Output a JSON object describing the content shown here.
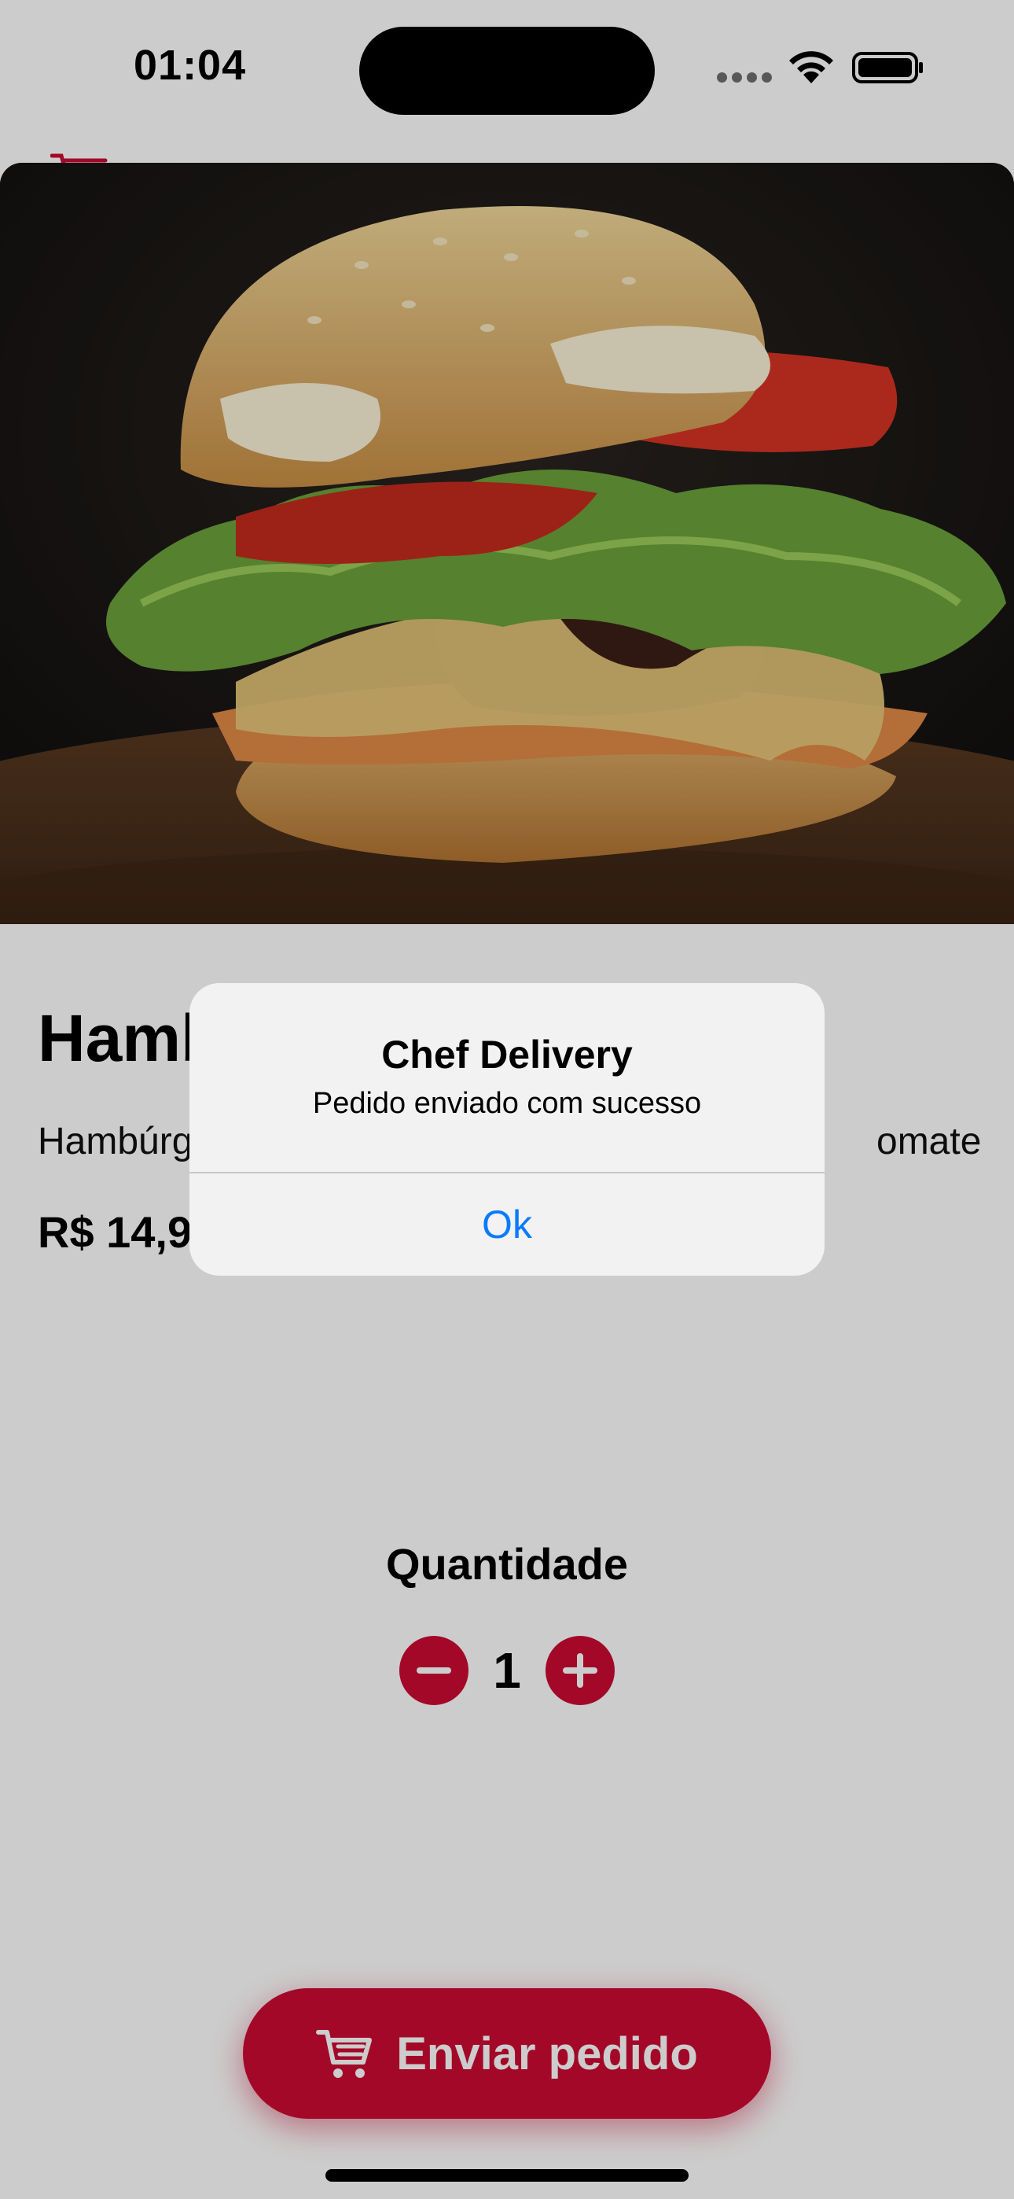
{
  "status_bar": {
    "time": "01:04",
    "icons": [
      "signal-dots-icon",
      "wifi-icon",
      "battery-icon"
    ]
  },
  "product": {
    "image": "hamburger-photo",
    "title": "Hamb",
    "description": "Hambúrg",
    "description_tail": "omate",
    "price": "R$ 14,9"
  },
  "quantity": {
    "label": "Quantidade",
    "value": "1",
    "decrement_icon": "minus-icon",
    "increment_icon": "plus-icon"
  },
  "send_button": {
    "label": "Enviar pedido",
    "icon": "cart-icon"
  },
  "alert": {
    "title": "Chef Delivery",
    "message": "Pedido enviado com sucesso",
    "ok_label": "Ok"
  },
  "colors": {
    "accent": "#cc0a33",
    "alert_button": "#0a7aff",
    "overlay": "rgba(0,0,0,0.2)"
  }
}
